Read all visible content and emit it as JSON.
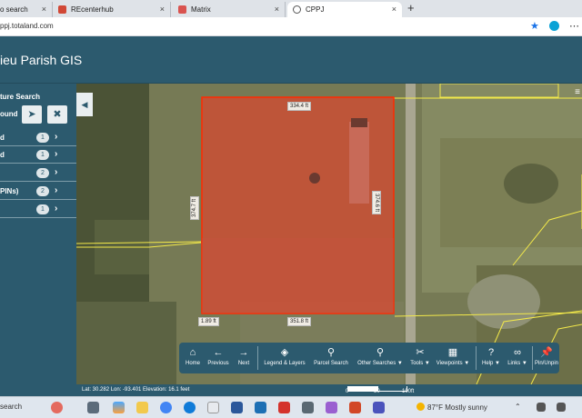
{
  "browser": {
    "tabs": [
      {
        "label": "o search",
        "color": "#1a73e8"
      },
      {
        "label": "REcenterhub",
        "color": "#d14836"
      },
      {
        "label": "Matrix",
        "color": "#d9534f"
      },
      {
        "label": "CPPJ",
        "color": "#555555"
      }
    ],
    "close_glyph": "×",
    "new_tab_glyph": "+",
    "url": "ppj.totaland.com",
    "icons": [
      "star-icon",
      "extension-icon",
      "menu-icon"
    ]
  },
  "app": {
    "title": "ieu Parish GIS"
  },
  "sidebar": {
    "title": "ture Search",
    "locate_label": "ound",
    "locate_icon": "➤",
    "clear_icon": "✖",
    "items": [
      {
        "label": "d",
        "count": "1"
      },
      {
        "label": "d",
        "count": "1"
      },
      {
        "label": "",
        "count": "2"
      },
      {
        "label": "PINs)",
        "count": "2"
      },
      {
        "label": "",
        "count": "1"
      }
    ],
    "chevron": "›"
  },
  "map": {
    "collapse_glyph": "◀",
    "menu_glyph": "≡",
    "measurements": {
      "top": "334.4 ft",
      "bottom": "351.8 ft",
      "left": "374.7 ft",
      "right": "374.6 ft",
      "corner": "1.89 ft"
    },
    "colors": {
      "parcel_fill": "#e0442c",
      "parcel_stroke": "#ff2a00",
      "parcel_lines": "#f3e94a"
    }
  },
  "toolbar": {
    "buttons": [
      {
        "label": "Home",
        "icon": "⌂"
      },
      {
        "label": "Previous",
        "icon": "←"
      },
      {
        "label": "Next",
        "icon": "→"
      },
      {
        "label": "Legend & Layers",
        "icon": "◈"
      },
      {
        "label": "Parcel Search",
        "icon": "⚲"
      },
      {
        "label": "Other Searches ▼",
        "icon": "⚲"
      },
      {
        "label": "Tools ▼",
        "icon": "✂"
      },
      {
        "label": "Viewpoints ▼",
        "icon": "▦"
      },
      {
        "label": "Help ▼",
        "icon": "?"
      },
      {
        "label": "Links ▼",
        "icon": "∞"
      },
      {
        "label": "Pin/Unpin",
        "icon": "📌"
      }
    ]
  },
  "status": {
    "coords": "Lat: 30.282   Lon: -93.401   Elevation: 16.1 feet",
    "scale_labels": [
      "0",
      "50",
      "100ft"
    ]
  },
  "taskbar": {
    "search": "search",
    "weather": "87°F  Mostly sunny",
    "tray_glyph": "⌃"
  }
}
